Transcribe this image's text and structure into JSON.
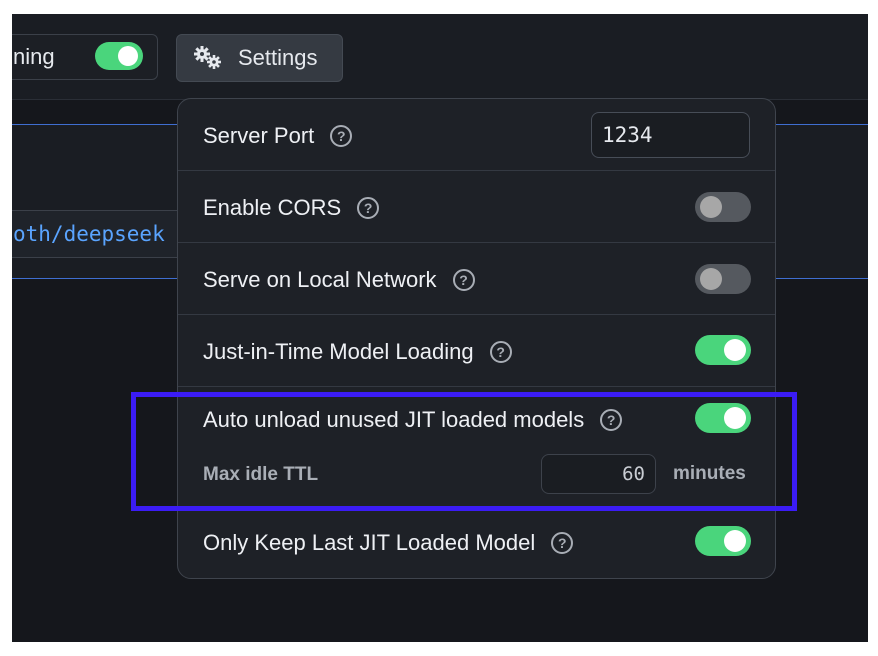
{
  "topbar": {
    "status_label": "ning",
    "status_toggle_on": true,
    "settings_button_label": "Settings",
    "settings_icon": "gears-icon"
  },
  "background": {
    "model_path": "oth/deepseek"
  },
  "settings": {
    "server_port": {
      "label": "Server Port",
      "value": "1234"
    },
    "enable_cors": {
      "label": "Enable CORS",
      "on": false
    },
    "serve_local_network": {
      "label": "Serve on Local Network",
      "on": false
    },
    "jit_loading": {
      "label": "Just-in-Time Model Loading",
      "on": true
    },
    "auto_unload": {
      "label": "Auto unload unused JIT loaded models",
      "on": true,
      "ttl_label": "Max idle TTL",
      "ttl_value": "60",
      "ttl_unit": "minutes"
    },
    "keep_last": {
      "label": "Only Keep Last JIT Loaded Model",
      "on": true
    },
    "help_icon": "question-circle-icon"
  },
  "colors": {
    "toggle_on": "#4ad57c",
    "toggle_off": "#55595f",
    "highlight": "#3b1cf5",
    "link": "#5aa4ff"
  }
}
